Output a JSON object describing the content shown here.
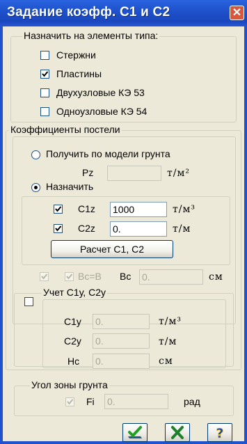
{
  "window": {
    "title": "Задание коэфф. С1 и С2",
    "close_label": "✕"
  },
  "element_types": {
    "legend": "Назначить на элементы типа:",
    "items": [
      {
        "label": "Стержни",
        "checked": false
      },
      {
        "label": "Пластины",
        "checked": true
      },
      {
        "label": "Двухузловые КЭ 53",
        "checked": false
      },
      {
        "label": "Одноузловые КЭ 54",
        "checked": false
      }
    ]
  },
  "bed_coeffs": {
    "legend": "Коэффициенты постели",
    "radio_soil_model": "Получить по модели грунта",
    "pz_label": "Pz",
    "pz_value": "",
    "pz_unit": "т/м²",
    "radio_assign": "Назначить",
    "selected_radio": "assign",
    "c1z_label": "C1z",
    "c1z_value": "1000",
    "c1z_unit": "т/м³",
    "c1z_checked": true,
    "c2z_label": "C2z",
    "c2z_value": "0.",
    "c2z_unit": "т/м",
    "c2z_checked": true,
    "calc_button": "Расчет С1, С2"
  },
  "bc_row": {
    "bc_eq_b_label": "Bc=B",
    "bc_label": "Bc",
    "bc_value": "0.",
    "bc_unit": "см"
  },
  "c1y_group": {
    "legend": "Учет С1у, С2у",
    "c1y_label": "C1y",
    "c1y_value": "0.",
    "c1y_unit": "т/м³",
    "c2y_label": "C2y",
    "c2y_value": "0.",
    "c2y_unit": "т/м",
    "hc_label": "Hc",
    "hc_value": "0.",
    "hc_unit": "см"
  },
  "soil_angle": {
    "legend": "Угол зоны грунта",
    "fi_label": "Fi",
    "fi_value": "0.",
    "fi_unit": "рад"
  },
  "buttons": [
    {
      "name": "ok-button",
      "icon": "check-icon"
    },
    {
      "name": "cancel-button",
      "icon": "x-icon"
    },
    {
      "name": "help-button",
      "icon": "question-icon"
    }
  ],
  "colors": {
    "title_bar": "#1f52cc",
    "dialog_bg": "#ece9d8",
    "check_green": "#21a121",
    "cancel_green": "#1e7e2a",
    "help_blue": "#1a3fb0"
  }
}
